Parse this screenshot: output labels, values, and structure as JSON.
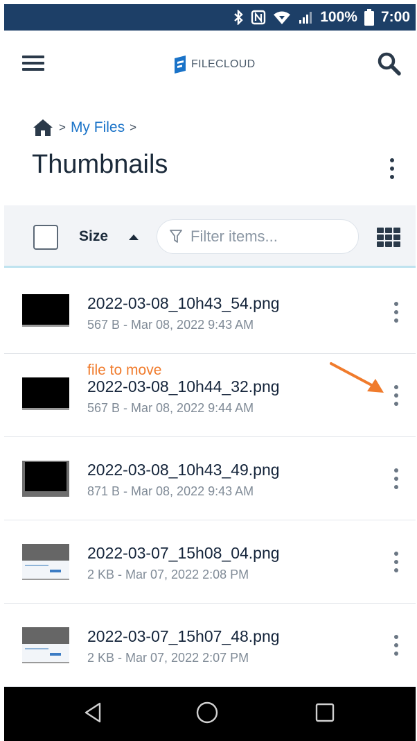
{
  "status_bar": {
    "battery_text": "100%",
    "time": "7:00",
    "icons": [
      "bluetooth-icon",
      "nfc-icon",
      "wifi-icon",
      "signal-icon",
      "battery-icon"
    ]
  },
  "header": {
    "logo_text": "FILECLOUD",
    "menu_icon": "hamburger-icon",
    "search_icon": "search-icon"
  },
  "breadcrumb": {
    "home_icon": "home-icon",
    "separator": ">",
    "items": [
      {
        "label": "My Files"
      }
    ]
  },
  "page": {
    "title": "Thumbnails"
  },
  "toolbar": {
    "sort_label": "Size",
    "sort_direction": "ascending",
    "filter_placeholder": "Filter items..."
  },
  "files": [
    {
      "name": "2022-03-08_10h43_54.png",
      "meta": "567 B - Mar 08, 2022 9:43 AM",
      "note": ""
    },
    {
      "name": "2022-03-08_10h44_32.png",
      "meta": "567 B - Mar 08, 2022 9:44 AM",
      "note": "file to move"
    },
    {
      "name": "2022-03-08_10h43_49.png",
      "meta": "871 B - Mar 08, 2022 9:43 AM",
      "note": ""
    },
    {
      "name": "2022-03-07_15h08_04.png",
      "meta": "2 KB - Mar 07, 2022 2:08 PM",
      "note": ""
    },
    {
      "name": "2022-03-07_15h07_48.png",
      "meta": "2 KB - Mar 07, 2022 2:07 PM",
      "note": ""
    }
  ],
  "colors": {
    "status_bar": "#1d3f67",
    "link": "#1a73c8",
    "annotation": "#f07b2c",
    "title": "#1b2a3a"
  }
}
